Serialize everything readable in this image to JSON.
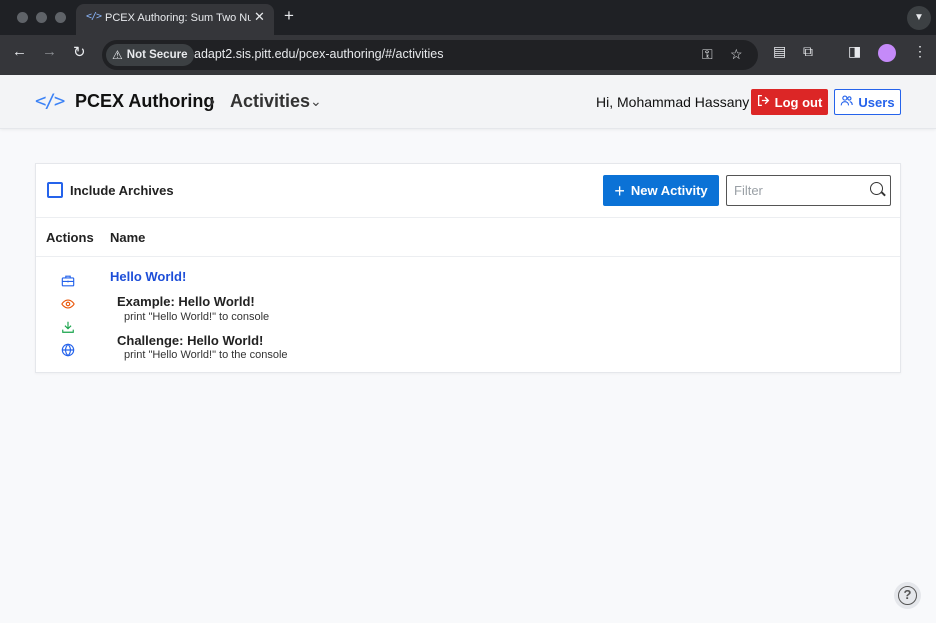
{
  "browser": {
    "tab_title": "PCEX Authoring: Sum Two Numbers",
    "tab_close": "✕",
    "new_tab": "+",
    "security_label": "Not Secure",
    "url": "adapt2.sis.pitt.edu/pcex-authoring/#/activities"
  },
  "header": {
    "brand": "PCEX Authoring",
    "breadcrumb": "Activities",
    "greeting": "Hi, Mohammad Hassany",
    "logout_label": "Log out",
    "users_label": "Users"
  },
  "toolbar": {
    "include_archives_label": "Include Archives",
    "new_activity_label": "New Activity",
    "filter_placeholder": "Filter",
    "filter_value": ""
  },
  "table": {
    "columns": [
      "Actions",
      "Name"
    ],
    "rows": [
      {
        "name": "Hello World!",
        "actions": [
          "briefcase-icon",
          "eye-icon",
          "download-icon",
          "globe-icon"
        ],
        "items": [
          {
            "title": "Example: Hello World!",
            "description": "print \"Hello World!\" to console"
          },
          {
            "title": "Challenge: Hello World!",
            "description": "print \"Hello World!\" to the console"
          }
        ]
      }
    ]
  },
  "help_label": "?",
  "colors": {
    "primary": "#0b72d6",
    "danger": "#dc2626",
    "link": "#1d4ed8",
    "view_icon": "#ea580c",
    "download_icon": "#16a34a"
  }
}
